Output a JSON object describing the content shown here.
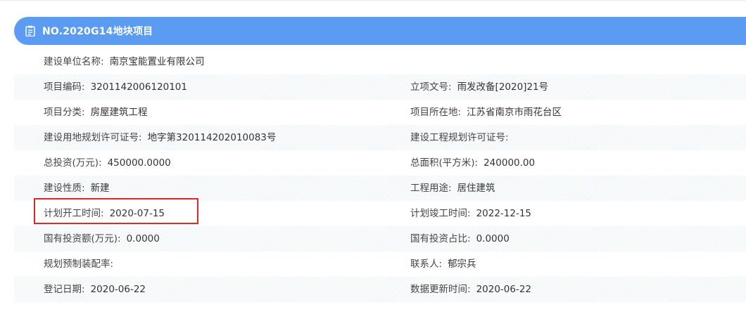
{
  "header": {
    "icon": "clipboard-icon",
    "title": "NO.2020G14地块项目"
  },
  "rows": [
    {
      "left": {
        "label": "建设单位名称:",
        "value": "南京宝能置业有限公司"
      }
    },
    {
      "left": {
        "label": "项目编码:",
        "value": "3201142006120101"
      },
      "right": {
        "label": "立项文号:",
        "value": "雨发改备[2020]21号"
      }
    },
    {
      "left": {
        "label": "项目分类:",
        "value": "房屋建筑工程"
      },
      "right": {
        "label": "项目所在地:",
        "value": "江苏省南京市雨花台区"
      }
    },
    {
      "left": {
        "label": "建设用地规划许可证号:",
        "value": "地字第320114202010083号"
      },
      "right": {
        "label": "建设工程规划许可证号:",
        "value": ""
      }
    },
    {
      "left": {
        "label": "总投资(万元):",
        "value": "450000.0000"
      },
      "right": {
        "label": "总面积(平方米):",
        "value": "240000.00"
      }
    },
    {
      "left": {
        "label": "建设性质:",
        "value": "新建"
      },
      "right": {
        "label": "工程用途:",
        "value": "居住建筑"
      }
    },
    {
      "left": {
        "label": "计划开工时间:",
        "value": "2020-07-15"
      },
      "right": {
        "label": "计划竣工时间:",
        "value": "2022-12-15"
      }
    },
    {
      "left": {
        "label": "国有投资额(万元):",
        "value": "0.0000"
      },
      "right": {
        "label": "国有投资占比:",
        "value": "0.0000"
      }
    },
    {
      "left": {
        "label": "规划预制装配率:",
        "value": ""
      },
      "right": {
        "label": "联系人:",
        "value": "郁宗兵"
      }
    },
    {
      "left": {
        "label": "登记日期:",
        "value": "2020-06-22"
      },
      "right": {
        "label": "数据更新时间:",
        "value": "2020-06-22"
      }
    }
  ],
  "colors": {
    "header_bg": "#5b9bf2",
    "highlight_border": "#e0262b"
  }
}
